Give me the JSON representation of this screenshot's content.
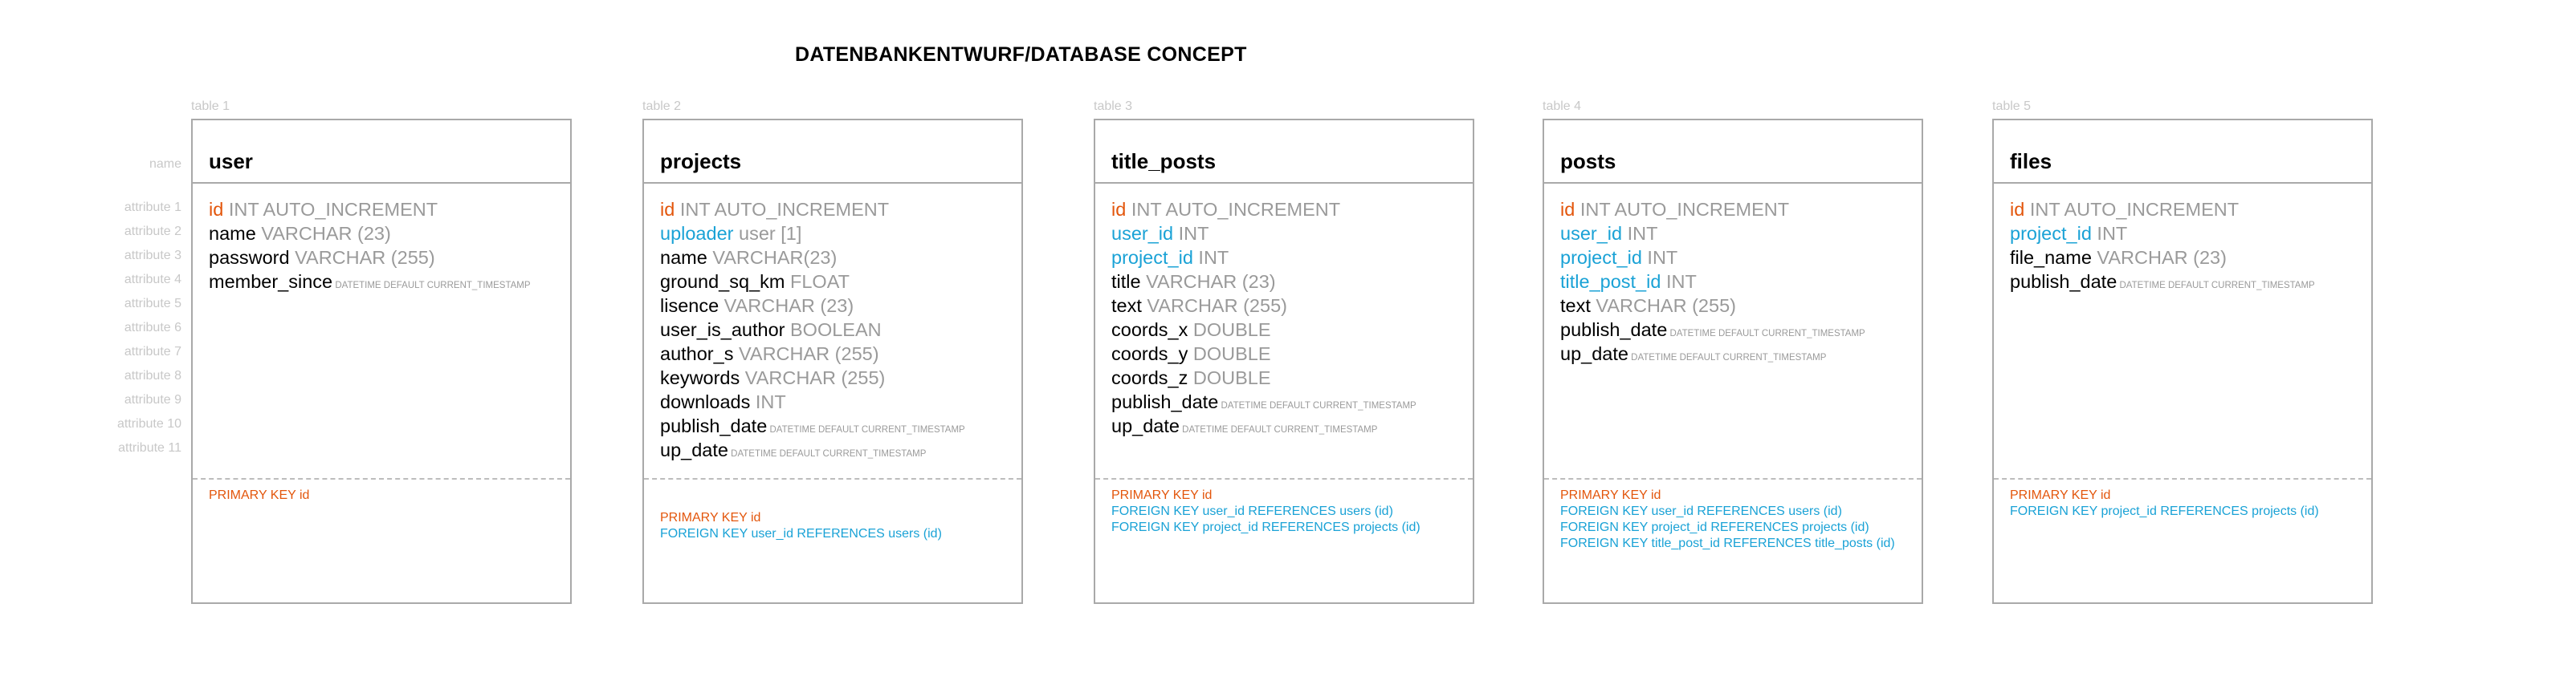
{
  "title": "DATENBANKENTWURF/DATABASE CONCEPT",
  "row_labels": {
    "name": "name",
    "attributes": [
      "attribute 1",
      "attribute 2",
      "attribute 3",
      "attribute 4",
      "attribute 5",
      "attribute 6",
      "attribute 7",
      "attribute 8",
      "attribute 9",
      "attribute 10",
      "attribute 11"
    ]
  },
  "tables": [
    {
      "label": "table 1",
      "name": "user",
      "attributes": [
        {
          "name": "id",
          "type": "INT AUTO_INCREMENT",
          "small": "",
          "kind": "pk"
        },
        {
          "name": "name",
          "type": "VARCHAR (23)",
          "small": "",
          "kind": "plain"
        },
        {
          "name": "password",
          "type": "VARCHAR (255)",
          "small": "",
          "kind": "plain"
        },
        {
          "name": "member_since",
          "type": "",
          "small": "DATETIME DEFAULT CURRENT_TIMESTAMP",
          "kind": "plain"
        }
      ],
      "keys": [
        {
          "text": "PRIMARY KEY id",
          "kind": "pk"
        }
      ]
    },
    {
      "label": "table 2",
      "name": "projects",
      "attributes": [
        {
          "name": "id",
          "type": "INT AUTO_INCREMENT",
          "small": "",
          "kind": "pk"
        },
        {
          "name": "uploader",
          "type": " user [1]",
          "small": "",
          "kind": "fk"
        },
        {
          "name": "name",
          "type": "VARCHAR(23)",
          "small": "",
          "kind": "plain"
        },
        {
          "name": "ground_sq_km",
          "type": "FLOAT",
          "small": "",
          "kind": "plain"
        },
        {
          "name": "lisence",
          "type": "VARCHAR (23)",
          "small": "",
          "kind": "plain"
        },
        {
          "name": "user_is_author",
          "type": "BOOLEAN",
          "small": "",
          "kind": "plain"
        },
        {
          "name": "author_s",
          "type": "VARCHAR (255)",
          "small": "",
          "kind": "plain"
        },
        {
          "name": "keywords",
          "type": "VARCHAR (255)",
          "small": "",
          "kind": "plain"
        },
        {
          "name": "downloads",
          "type": "INT",
          "small": "",
          "kind": "plain"
        },
        {
          "name": "publish_date",
          "type": "",
          "small": "DATETIME DEFAULT CURRENT_TIMESTAMP",
          "kind": "plain"
        },
        {
          "name": "up_date",
          "type": "",
          "small": "DATETIME DEFAULT CURRENT_TIMESTAMP",
          "kind": "plain"
        }
      ],
      "keys": [
        {
          "text": "PRIMARY KEY id",
          "kind": "pk"
        },
        {
          "text": "FOREIGN KEY user_id REFERENCES users (id)",
          "kind": "fk"
        }
      ]
    },
    {
      "label": "table 3",
      "name": "title_posts",
      "attributes": [
        {
          "name": "id",
          "type": "INT AUTO_INCREMENT",
          "small": "",
          "kind": "pk"
        },
        {
          "name": "user_id",
          "type": "INT",
          "small": "",
          "kind": "fk"
        },
        {
          "name": "project_id",
          "type": "INT",
          "small": "",
          "kind": "fk"
        },
        {
          "name": "title",
          "type": "VARCHAR (23)",
          "small": "",
          "kind": "plain"
        },
        {
          "name": "text",
          "type": "VARCHAR (255)",
          "small": "",
          "kind": "plain"
        },
        {
          "name": "coords_x",
          "type": "DOUBLE",
          "small": "",
          "kind": "plain"
        },
        {
          "name": "coords_y",
          "type": "DOUBLE",
          "small": "",
          "kind": "plain"
        },
        {
          "name": "coords_z",
          "type": "DOUBLE",
          "small": "",
          "kind": "plain"
        },
        {
          "name": "publish_date",
          "type": "",
          "small": "DATETIME DEFAULT CURRENT_TIMESTAMP",
          "kind": "plain"
        },
        {
          "name": "up_date",
          "type": "",
          "small": "DATETIME DEFAULT CURRENT_TIMESTAMP",
          "kind": "plain"
        }
      ],
      "keys": [
        {
          "text": "PRIMARY KEY id",
          "kind": "pk"
        },
        {
          "text": "FOREIGN KEY user_id REFERENCES users (id)",
          "kind": "fk"
        },
        {
          "text": "FOREIGN KEY project_id REFERENCES projects (id)",
          "kind": "fk"
        }
      ]
    },
    {
      "label": "table 4",
      "name": "posts",
      "attributes": [
        {
          "name": "id",
          "type": "INT AUTO_INCREMENT",
          "small": "",
          "kind": "pk"
        },
        {
          "name": "user_id",
          "type": "INT",
          "small": "",
          "kind": "fk"
        },
        {
          "name": "project_id",
          "type": "INT",
          "small": "",
          "kind": "fk"
        },
        {
          "name": "title_post_id",
          "type": "INT",
          "small": "",
          "kind": "fk"
        },
        {
          "name": "text",
          "type": "VARCHAR (255)",
          "small": "",
          "kind": "plain"
        },
        {
          "name": "publish_date",
          "type": "",
          "small": "DATETIME DEFAULT CURRENT_TIMESTAMP",
          "kind": "plain"
        },
        {
          "name": "up_date",
          "type": "",
          "small": "DATETIME DEFAULT CURRENT_TIMESTAMP",
          "kind": "plain"
        }
      ],
      "keys": [
        {
          "text": "PRIMARY KEY id",
          "kind": "pk"
        },
        {
          "text": "FOREIGN KEY user_id REFERENCES users (id)",
          "kind": "fk"
        },
        {
          "text": "FOREIGN KEY project_id REFERENCES projects (id)",
          "kind": "fk"
        },
        {
          "text": "FOREIGN KEY title_post_id REFERENCES title_posts (id)",
          "kind": "fk"
        }
      ]
    },
    {
      "label": "table 5",
      "name": "files",
      "attributes": [
        {
          "name": "id",
          "type": "INT AUTO_INCREMENT",
          "small": "",
          "kind": "pk"
        },
        {
          "name": "project_id",
          "type": "INT",
          "small": "",
          "kind": "fk"
        },
        {
          "name": "file_name",
          "type": "VARCHAR (23)",
          "small": "",
          "kind": "plain"
        },
        {
          "name": "publish_date",
          "type": "",
          "small": "DATETIME DEFAULT CURRENT_TIMESTAMP",
          "kind": "plain"
        }
      ],
      "keys": [
        {
          "text": "PRIMARY KEY id",
          "kind": "pk"
        },
        {
          "text": "FOREIGN KEY project_id REFERENCES projects (id)",
          "kind": "fk"
        }
      ]
    }
  ]
}
